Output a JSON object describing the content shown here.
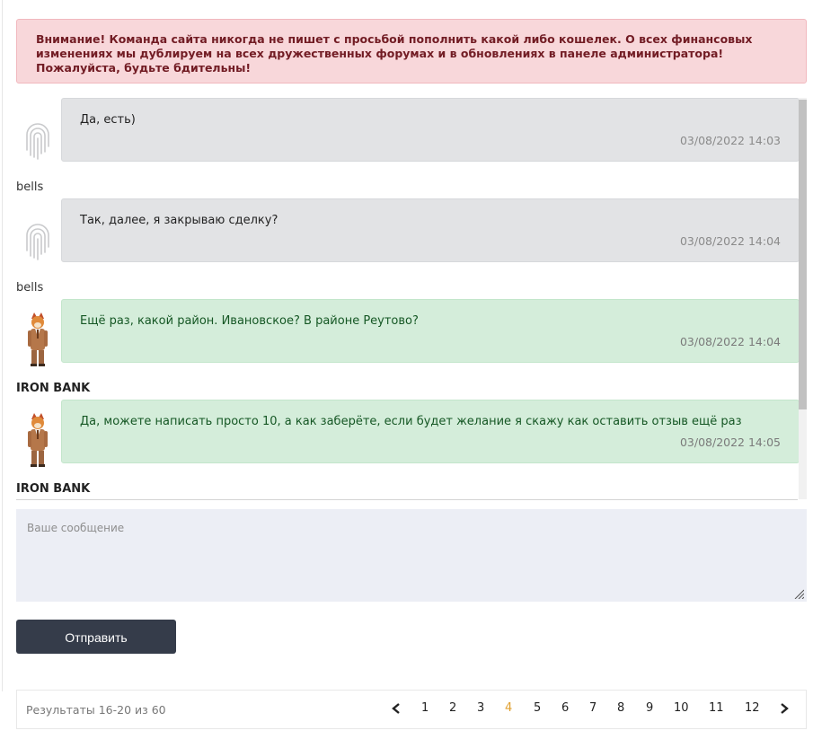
{
  "alert": {
    "text": "Внимание! Команда сайта никогда не пишет с просьбой пополнить какой либо кошелек. О всех финансовых изменениях мы дублируем на всех дружественных форумах и в обновлениях в панеле администратора! Пожалуйста, будьте бдительны!"
  },
  "messages": [
    {
      "text": "Да, есть)",
      "time": "03/08/2022 14:03",
      "author": "bells",
      "style": "gray"
    },
    {
      "text": "Так, далее, я закрываю сделку?",
      "time": "03/08/2022 14:04",
      "author": "bells",
      "style": "gray"
    },
    {
      "text": "Ещё раз, какой район. Ивановское? В районе Реутово?",
      "time": "03/08/2022 14:04",
      "author": "IRON BANK",
      "style": "green"
    },
    {
      "text": "Да, можете написать просто 10, а как заберёте, если будет желание я скажу как оставить отзыв ещё раз",
      "time": "03/08/2022 14:05",
      "author": "IRON BANK",
      "style": "green"
    }
  ],
  "composer": {
    "placeholder": "Ваше сообщение",
    "send_label": "Отправить"
  },
  "pagination": {
    "summary": "Результаты 16-20 из 60",
    "pages": [
      "1",
      "2",
      "3",
      "4",
      "5",
      "6",
      "7",
      "8",
      "9",
      "10",
      "11",
      "12"
    ],
    "current": "4"
  },
  "colors": {
    "alert_bg": "#f8d7da",
    "alert_text": "#721c24",
    "gray_bubble": "#e2e3e5",
    "green_bubble": "#d4edda",
    "green_text": "#155724",
    "button_bg": "#353c4a",
    "active_page": "#e0a030"
  },
  "icons": {
    "fingerprint": "fingerprint-avatar-icon",
    "cartoon": "cartoon-avatar-icon",
    "prev": "chevron-left-icon",
    "next": "chevron-right-icon",
    "resize": "resize-handle-icon"
  }
}
